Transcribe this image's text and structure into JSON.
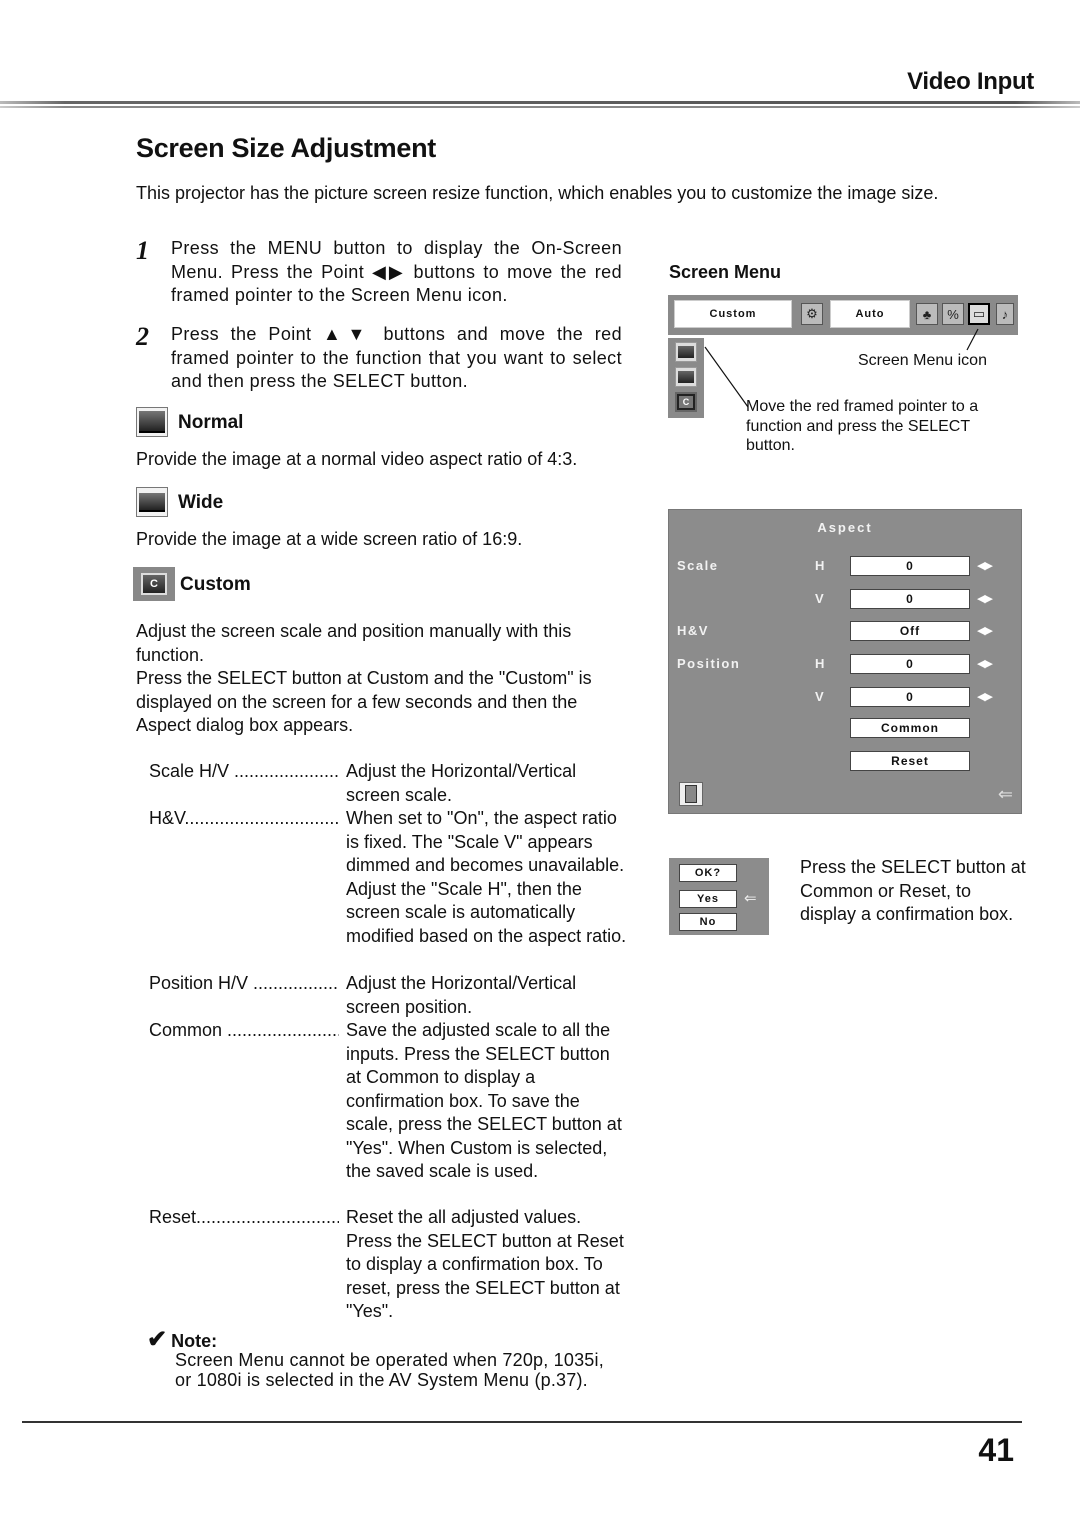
{
  "header": {
    "section": "Video Input"
  },
  "page": {
    "title": "Screen Size Adjustment",
    "intro": "This projector has the picture screen resize function, which enables you to customize the image size.",
    "number": "41"
  },
  "steps": [
    {
      "num": "1",
      "text": "Press the MENU button to display the On-Screen Menu.  Press the Point ◀▶ buttons to move the red framed pointer to the Screen Menu icon."
    },
    {
      "num": "2",
      "text": "Press the Point ▲▼ buttons and move the red framed pointer to the function that you want to select and then press the SELECT button."
    }
  ],
  "options": {
    "normal": {
      "label": "Normal",
      "icon": "normal-screen-icon",
      "desc": "Provide the image at a normal video aspect ratio of 4:3."
    },
    "wide": {
      "label": "Wide",
      "icon": "wide-screen-icon",
      "desc": "Provide the image at a wide screen ratio of 16:9."
    },
    "custom": {
      "label": "Custom",
      "icon": "custom-screen-icon",
      "icon_glyph": "C",
      "desc1": "Adjust the screen scale and position manually with this function.",
      "desc2": "Press the SELECT button at Custom and the \"Custom\" is displayed on the screen for a few seconds and then the Aspect dialog box appears."
    }
  },
  "definitions": [
    {
      "term": "Scale H/V ..............................",
      "desc": "Adjust the Horizontal/Vertical screen scale."
    },
    {
      "term": "H&V.....................................",
      "desc": "When set to \"On\", the aspect ratio is fixed. The \"Scale V\" appears dimmed and becomes unavailable. Adjust the \"Scale H\", then the screen scale is automatically modified based on the aspect ratio."
    },
    {
      "term": "Position H/V ..........................",
      "desc": "Adjust the Horizontal/Vertical screen position."
    },
    {
      "term": "Common ...............................",
      "desc": "Save the adjusted scale to all the inputs. Press the SELECT button at Common to display a confirmation box. To save the scale, press the SELECT button at \"Yes\". When Custom is selected, the saved scale is used."
    },
    {
      "term": "Reset.....................................",
      "desc": "Reset the all adjusted values. Press the SELECT button at Reset to display a confirmation box. To reset, press the SELECT button at \"Yes\"."
    }
  ],
  "note": {
    "check": "✔",
    "title": "Note:",
    "text": "Screen Menu cannot be operated when 720p, 1035i, or 1080i is selected in the AV System Menu (p.37)."
  },
  "screen_menu_figure": {
    "label": "Screen Menu",
    "menubar": {
      "input_value": "Custom",
      "source_value": "Auto",
      "icons": [
        "input-icon",
        "image-select-icon",
        "image-adjust-icon",
        "screen-menu-icon",
        "sound-icon"
      ]
    },
    "callout_icon": "Screen Menu icon",
    "callout_pointer": "Move the red framed pointer to a function and press the SELECT button."
  },
  "aspect_dialog": {
    "title": "Aspect",
    "rows": [
      {
        "label": "Scale",
        "axis": "H",
        "value": "0",
        "arrows": "◀▶"
      },
      {
        "label": "",
        "axis": "V",
        "value": "0",
        "arrows": "◀▶"
      },
      {
        "label": "H&V",
        "axis": "",
        "value": "Off",
        "arrows": "◀▶"
      },
      {
        "label": "Position",
        "axis": "H",
        "value": "0",
        "arrows": "◀▶"
      },
      {
        "label": "",
        "axis": "V",
        "value": "0",
        "arrows": "◀▶"
      }
    ],
    "common_button": "Common",
    "reset_button": "Reset",
    "back_glyph": "⇐"
  },
  "confirm_dialog": {
    "prompt": "OK?",
    "yes": "Yes",
    "no": "No",
    "arrow": "⇐",
    "caption": "Press the SELECT button at Common or Reset, to display a confirmation box."
  }
}
